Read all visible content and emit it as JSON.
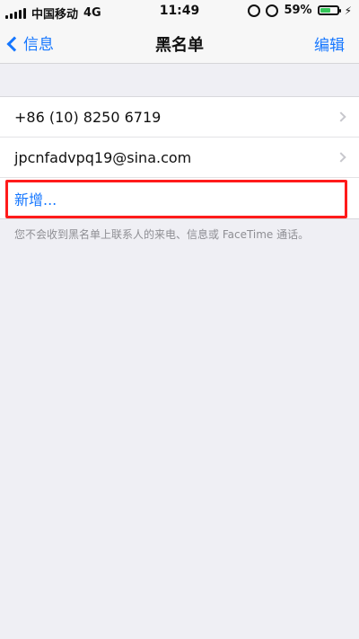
{
  "status_bar": {
    "carrier": "中国移动",
    "network": "4G",
    "time": "11:49",
    "battery_percent": "59%",
    "battery_level": 0.59,
    "battery_color": "#34c759",
    "icons": [
      "signal-icon",
      "rotation-lock-icon",
      "alarm-icon",
      "battery-icon",
      "charging-icon"
    ]
  },
  "nav": {
    "back_label": "信息",
    "title": "黑名单",
    "edit_label": "编辑",
    "accent": "#1677ff"
  },
  "list": {
    "rows": [
      {
        "text": "+86 (10) 8250 6719"
      },
      {
        "text": "jpcnfadvpq19@sina.com"
      }
    ],
    "add_label": "新增..."
  },
  "footer_note": "您不会收到黑名单上联系人的来电、信息或 FaceTime 通话。"
}
